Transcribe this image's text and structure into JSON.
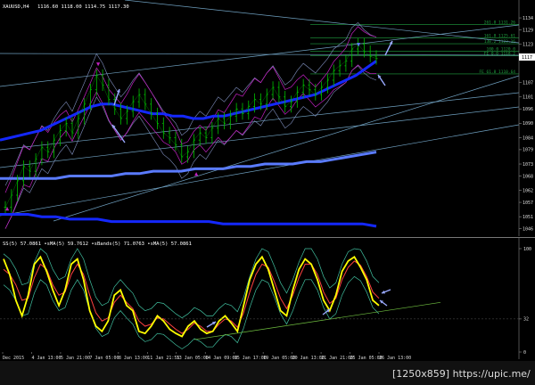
{
  "header": {
    "symbol_text": "XAUUSD,H4",
    "ohlc_text": "1116.60 1118.00 1114.75 1117.30"
  },
  "osc_header_text": "SS(5) 57.0861  ∙sMA(5) 59.7612  ∙sBands(5) 71.0763  ∙sMA(5) 57.0861",
  "watermark": "[1250x859] https://upic.me/",
  "colors": {
    "candle": "#00c000",
    "ma_blue": "#1428ff",
    "ma_light": "#5a7bff",
    "bands": "#c020c0",
    "envelope": "#8090c0",
    "channel": "#6fa0c0",
    "fib": "#20a040",
    "stoch": "#ffff00",
    "stoch_sig": "#ff4040",
    "stoch_bands": "#40c0a0",
    "arrow": "#9aaaff"
  },
  "chart_data": [
    {
      "type": "line",
      "title": "",
      "instrument": "XAUUSD,H4",
      "y_ticks": [
        "1134",
        "1129",
        "1123",
        "1117",
        "1107",
        "1101",
        "1096",
        "1090",
        "1084",
        "1079",
        "1073",
        "1068",
        "1062",
        "1057",
        "1051",
        "1046"
      ],
      "ylim": [
        1044,
        1137
      ],
      "fib_levels": [
        {
          "label": "261.8 1131.26",
          "value": 1131.3
        },
        {
          "label": "161.8 1125.61",
          "value": 1125.6
        },
        {
          "label": "138.2 1123.16",
          "value": 1123.2
        },
        {
          "label": "100.0 1120.0",
          "value": 1120.0
        },
        {
          "label": "FE 0.0 1118.2",
          "value": 1118.2
        },
        {
          "label": "FE 61.8 1110.64",
          "value": 1110.6
        }
      ],
      "current_price_label": "1117",
      "series": [
        {
          "values": [
            1055,
            1060,
            1066,
            1072,
            1070,
            1075,
            1080,
            1078,
            1083,
            1087,
            1090,
            1086,
            1092,
            1098,
            1104,
            1110,
            1106,
            1100,
            1096,
            1092,
            1095,
            1099,
            1102,
            1098,
            1094,
            1090,
            1086,
            1084,
            1081,
            1076,
            1078,
            1083,
            1086,
            1084,
            1088,
            1092,
            1090,
            1093,
            1096,
            1094,
            1097,
            1100,
            1098,
            1102,
            1105,
            1101,
            1097,
            1099,
            1103,
            1106,
            1104,
            1102,
            1105,
            1108,
            1112,
            1114,
            1116,
            1121,
            1123,
            1120,
            1118,
            1117
          ]
        },
        {
          "values": [
            1083,
            1084,
            1085,
            1086,
            1087,
            1089,
            1091,
            1093,
            1095,
            1097,
            1098,
            1098,
            1097,
            1096,
            1095,
            1094,
            1094,
            1093,
            1093,
            1092,
            1092,
            1093,
            1093,
            1094,
            1095,
            1096,
            1097,
            1098,
            1099,
            1100,
            1101,
            1102,
            1104,
            1106,
            1108,
            1110,
            1113,
            1116
          ]
        },
        {
          "values": [
            1067,
            1067,
            1067,
            1067,
            1067,
            1068,
            1068,
            1068,
            1068,
            1069,
            1069,
            1070,
            1070,
            1070,
            1071,
            1071,
            1071,
            1072,
            1072,
            1073,
            1073,
            1073,
            1074,
            1074,
            1075,
            1076,
            1077,
            1078
          ]
        },
        {
          "values": [
            1052,
            1052,
            1052,
            1051,
            1051,
            1050,
            1050,
            1050,
            1049,
            1049,
            1049,
            1049,
            1049,
            1049,
            1049,
            1049,
            1048,
            1048,
            1048,
            1048,
            1048,
            1048,
            1048,
            1048,
            1048,
            1048,
            1048,
            1047
          ]
        }
      ]
    },
    {
      "type": "line",
      "title": "",
      "y_ticks": [
        "100",
        "32",
        "0"
      ],
      "ylim": [
        0,
        100
      ],
      "series": [
        {
          "values": [
            90,
            75,
            50,
            35,
            55,
            85,
            92,
            78,
            60,
            45,
            60,
            85,
            90,
            70,
            40,
            25,
            20,
            30,
            55,
            60,
            45,
            40,
            20,
            18,
            25,
            35,
            30,
            22,
            18,
            15,
            25,
            30,
            22,
            18,
            20,
            30,
            35,
            28,
            20,
            45,
            70,
            85,
            92,
            80,
            60,
            40,
            35,
            60,
            80,
            90,
            85,
            70,
            50,
            40,
            55,
            78,
            88,
            92,
            82,
            70,
            50,
            45
          ]
        },
        {
          "values": [
            80,
            75,
            65,
            50,
            52,
            72,
            85,
            80,
            65,
            55,
            58,
            75,
            85,
            75,
            55,
            38,
            30,
            33,
            48,
            55,
            48,
            42,
            30,
            25,
            27,
            33,
            32,
            27,
            22,
            18,
            22,
            28,
            25,
            20,
            20,
            27,
            32,
            30,
            24,
            38,
            58,
            75,
            85,
            82,
            68,
            52,
            42,
            55,
            72,
            85,
            85,
            75,
            58,
            47,
            52,
            70,
            82,
            88,
            84,
            73,
            58,
            52
          ]
        }
      ],
      "annotation": "trend line"
    }
  ],
  "x_ticks": [
    "Dec 2015",
    "4 Jan 13:00",
    "5 Jan 21:00",
    "7 Jan 05:00",
    "8 Jan 13:00",
    "11 Jan 21:55",
    "13 Jan 05:00",
    "14 Jan 09:00",
    "15 Jan 17:00",
    "19 Jan 05:00",
    "20 Jan 13:00",
    "21 Jan 21:00",
    "25 Jan 05:00",
    "26 Jan 13:00"
  ]
}
